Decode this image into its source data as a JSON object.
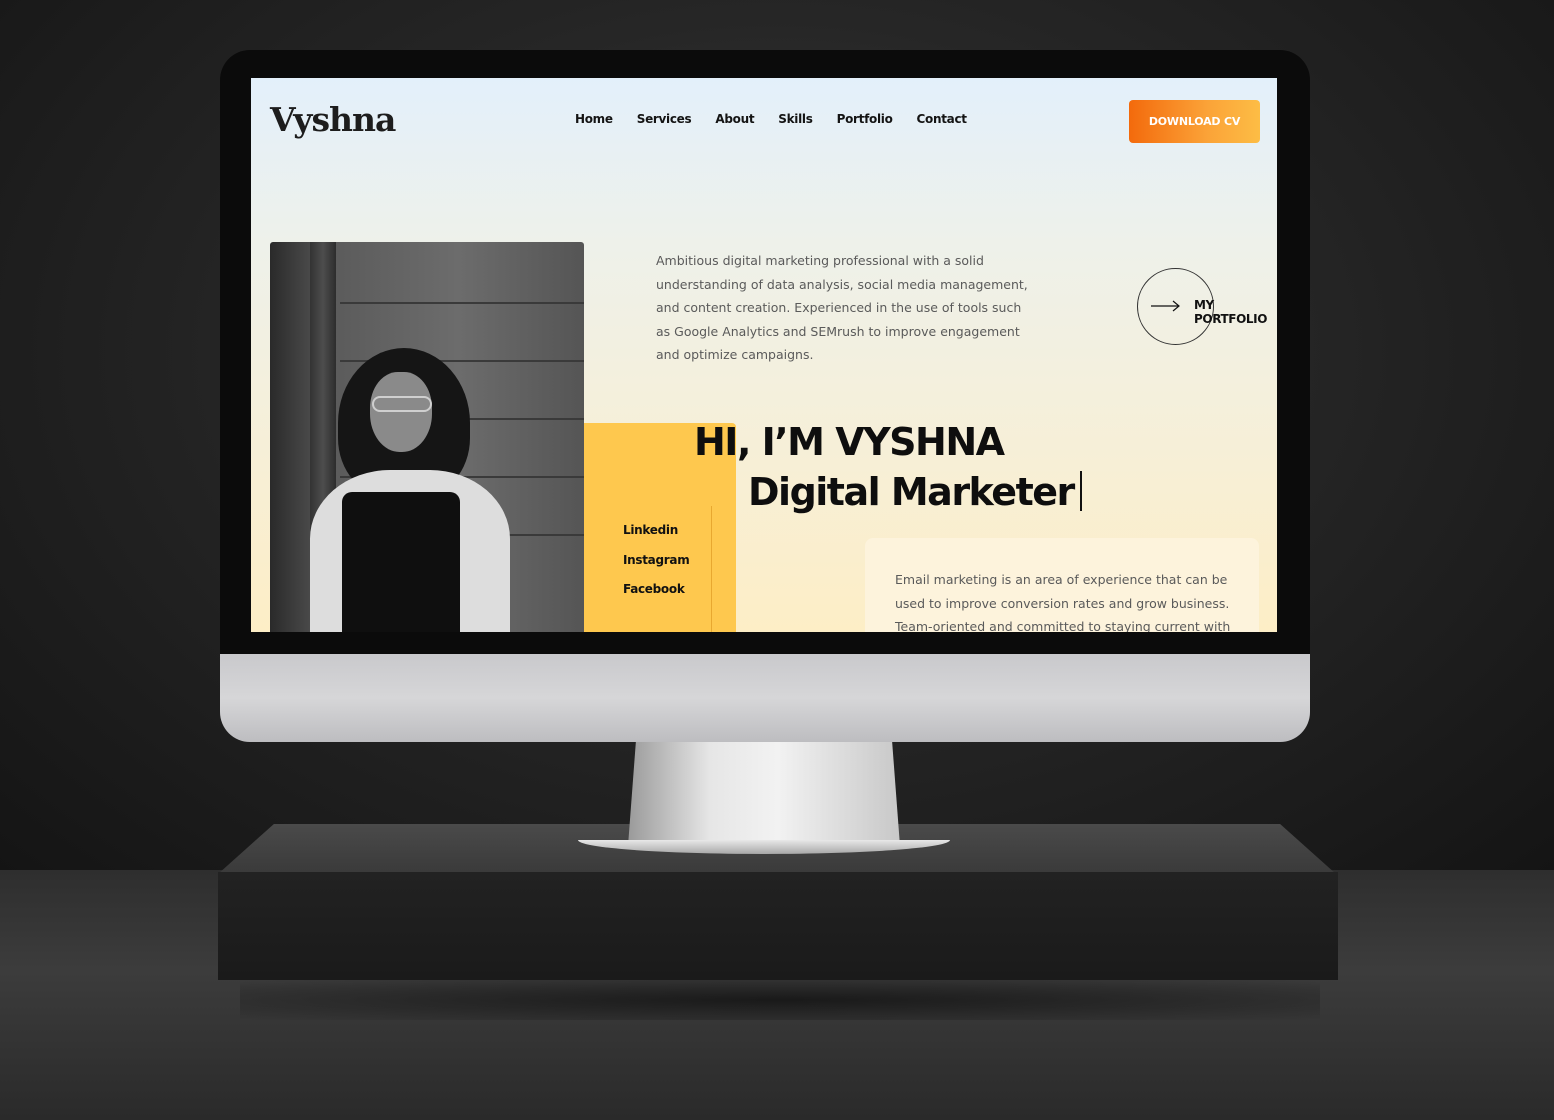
{
  "site": {
    "logo": "Vyshna",
    "nav": [
      "Home",
      "Services",
      "About",
      "Skills",
      "Portfolio",
      "Contact"
    ],
    "cta_button": "DOWNLOAD CV",
    "intro": "Ambitious digital marketing professional with a solid understanding of data analysis, social media management, and content creation. Experienced in the use of tools such as Google Analytics and SEMrush to improve engagement and optimize campaigns.",
    "portfolio_link": "MY PORTFOLIO",
    "hero_line_1": "HI, I’M VYSHNA",
    "hero_line_2": "Digital Marketer",
    "social": [
      "Linkedin",
      "Instagram",
      "Facebook"
    ],
    "email_card": "Email marketing is an area of experience that can be used to improve conversion rates and grow business. Team-oriented and committed to staying current with"
  },
  "colors": {
    "accent_orange": "#f36a0c",
    "accent_yellow": "#fec84e",
    "text_dark": "#0e0e0e",
    "text_body": "#5a5a5a"
  },
  "icons": {
    "arrow": "arrow-right-icon"
  }
}
